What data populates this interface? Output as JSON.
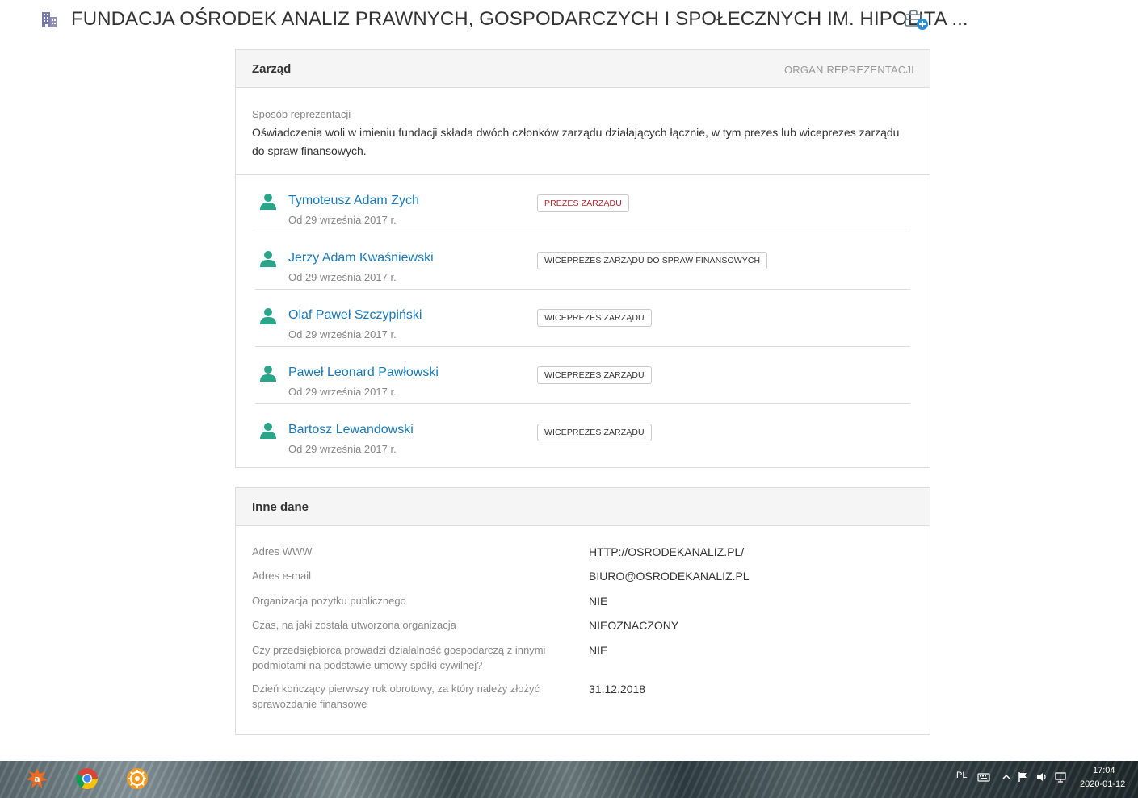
{
  "header": {
    "title": "FUNDACJA OŚRODEK ANALIZ PRAWNYCH, GOSPODARCZYCH I SPOŁECZNYCH IM. HIPOLITA ...",
    "building_icon": "building-icon",
    "add_icon": "briefcase-add-icon"
  },
  "zarzad": {
    "title": "Zarząd",
    "right_label": "ORGAN REPREZENTACJI",
    "repr_label": "Sposób reprezentacji",
    "repr_text": "Oświadczenia woli w imieniu fundacji składa dwóch członków zarządu działających łącznie, w tym prezes lub wiceprezes zarządu do spraw finansowych.",
    "members": [
      {
        "name": "Tymoteusz Adam Zych",
        "since": "Od 29 września 2017 r.",
        "role": "PREZES ZARZĄDU",
        "role_color": "#b3232b"
      },
      {
        "name": "Jerzy Adam Kwaśniewski",
        "since": "Od 29 września 2017 r.",
        "role": "WICEPREZES ZARZĄDU DO SPRAW FINANSOWYCH",
        "role_color": "#333333"
      },
      {
        "name": "Olaf Paweł Szczypiński",
        "since": "Od 29 września 2017 r.",
        "role": "WICEPREZES ZARZĄDU",
        "role_color": "#333333"
      },
      {
        "name": "Paweł Leonard Pawłowski",
        "since": "Od 29 września 2017 r.",
        "role": "WICEPREZES ZARZĄDU",
        "role_color": "#333333"
      },
      {
        "name": "Bartosz Lewandowski",
        "since": "Od 29 września 2017 r.",
        "role": "WICEPREZES ZARZĄDU",
        "role_color": "#333333"
      }
    ]
  },
  "inne": {
    "title": "Inne dane",
    "rows": [
      {
        "label": "Adres WWW",
        "value": "HTTP://OSRODEKANALIZ.PL/"
      },
      {
        "label": "Adres e-mail",
        "value": "BIURO@OSRODEKANALIZ.PL"
      },
      {
        "label": "Organizacja pożytku publicznego",
        "value": "NIE"
      },
      {
        "label": "Czas, na jaki została utworzona organizacja",
        "value": "NIEOZNACZONY"
      },
      {
        "label": "Czy przedsiębiorca prowadzi działalność gospodarczą z innymi podmiotami na podstawie umowy spółki cywilnej?",
        "value": "NIE"
      },
      {
        "label": "Dzień kończący pierwszy rok obrotowy, za który należy złożyć sprawozdanie finansowe",
        "value": "31.12.2018"
      }
    ]
  },
  "taskbar": {
    "apps": [
      "avast-icon",
      "chrome-icon",
      "settings-wheel-icon"
    ],
    "language": "PL",
    "time": "17:04",
    "date": "2020-01-12"
  },
  "colors": {
    "link": "#1a7ab8",
    "person_icon": "#2aa58a",
    "badge_red": "#b3232b",
    "panel_head": "#f5f5f5",
    "border": "#dddddd"
  }
}
